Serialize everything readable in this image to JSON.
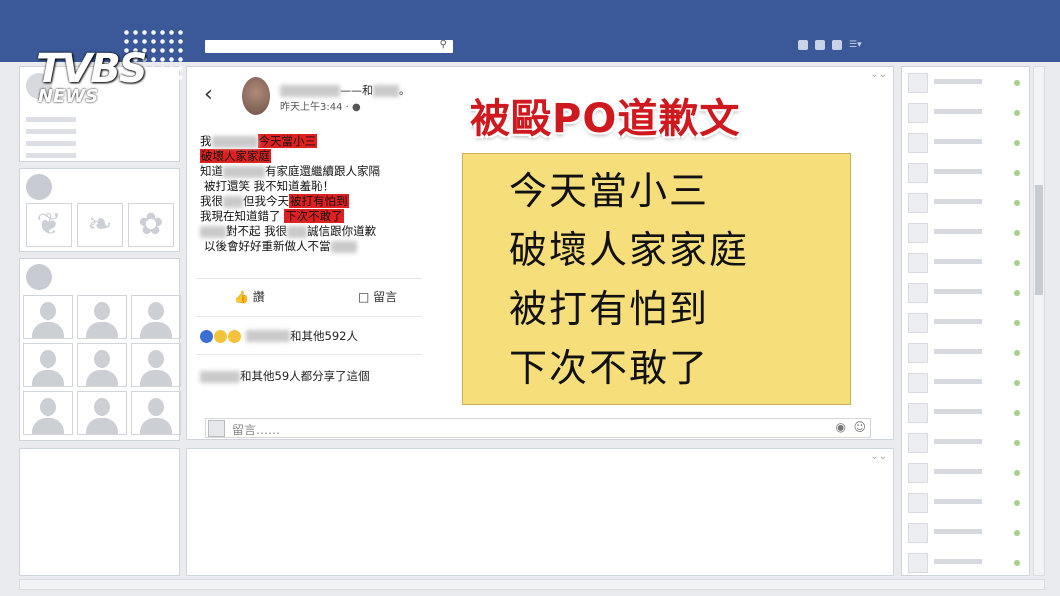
{
  "post": {
    "name_sep": "——和",
    "name_end": "。",
    "time": "昨天上午3:44 · ",
    "lines": [
      {
        "a": "我",
        "b": "今天當小三"
      },
      {
        "b": "破壞人家家庭"
      },
      {
        "a": "知道",
        "b": "有家庭還繼續跟人家隔"
      },
      {
        "a": "被打還笑 我不知道羞恥！"
      },
      {
        "a": "我很",
        "b": "但我今天",
        "c": "被打有怕到"
      },
      {
        "a": "我現在知道錯了 ",
        "b": "下次不敢了"
      },
      {
        "a": "對不起 我很",
        "b": "誠信跟你道歉"
      },
      {
        "a": "以後會好好重新做人不當"
      }
    ],
    "like_label": "讚",
    "comment_label": "留言",
    "likes_text": "和其他592人",
    "shares_text": "和其他59人都分享了這個"
  },
  "overlay": {
    "headline": "被毆PO道歉文",
    "lines": [
      "今天當小三",
      "破壞人家家庭",
      "被打有怕到",
      "下次不敢了"
    ]
  },
  "comment": {
    "placeholder": "留言……"
  },
  "logo": {
    "brand": "TVBS",
    "sub": "NEWS"
  },
  "colors": {
    "topbar": "#3b5998",
    "highlight": "#e02020",
    "headline": "#d0191e",
    "overlay_bg": "#f6df7a"
  }
}
